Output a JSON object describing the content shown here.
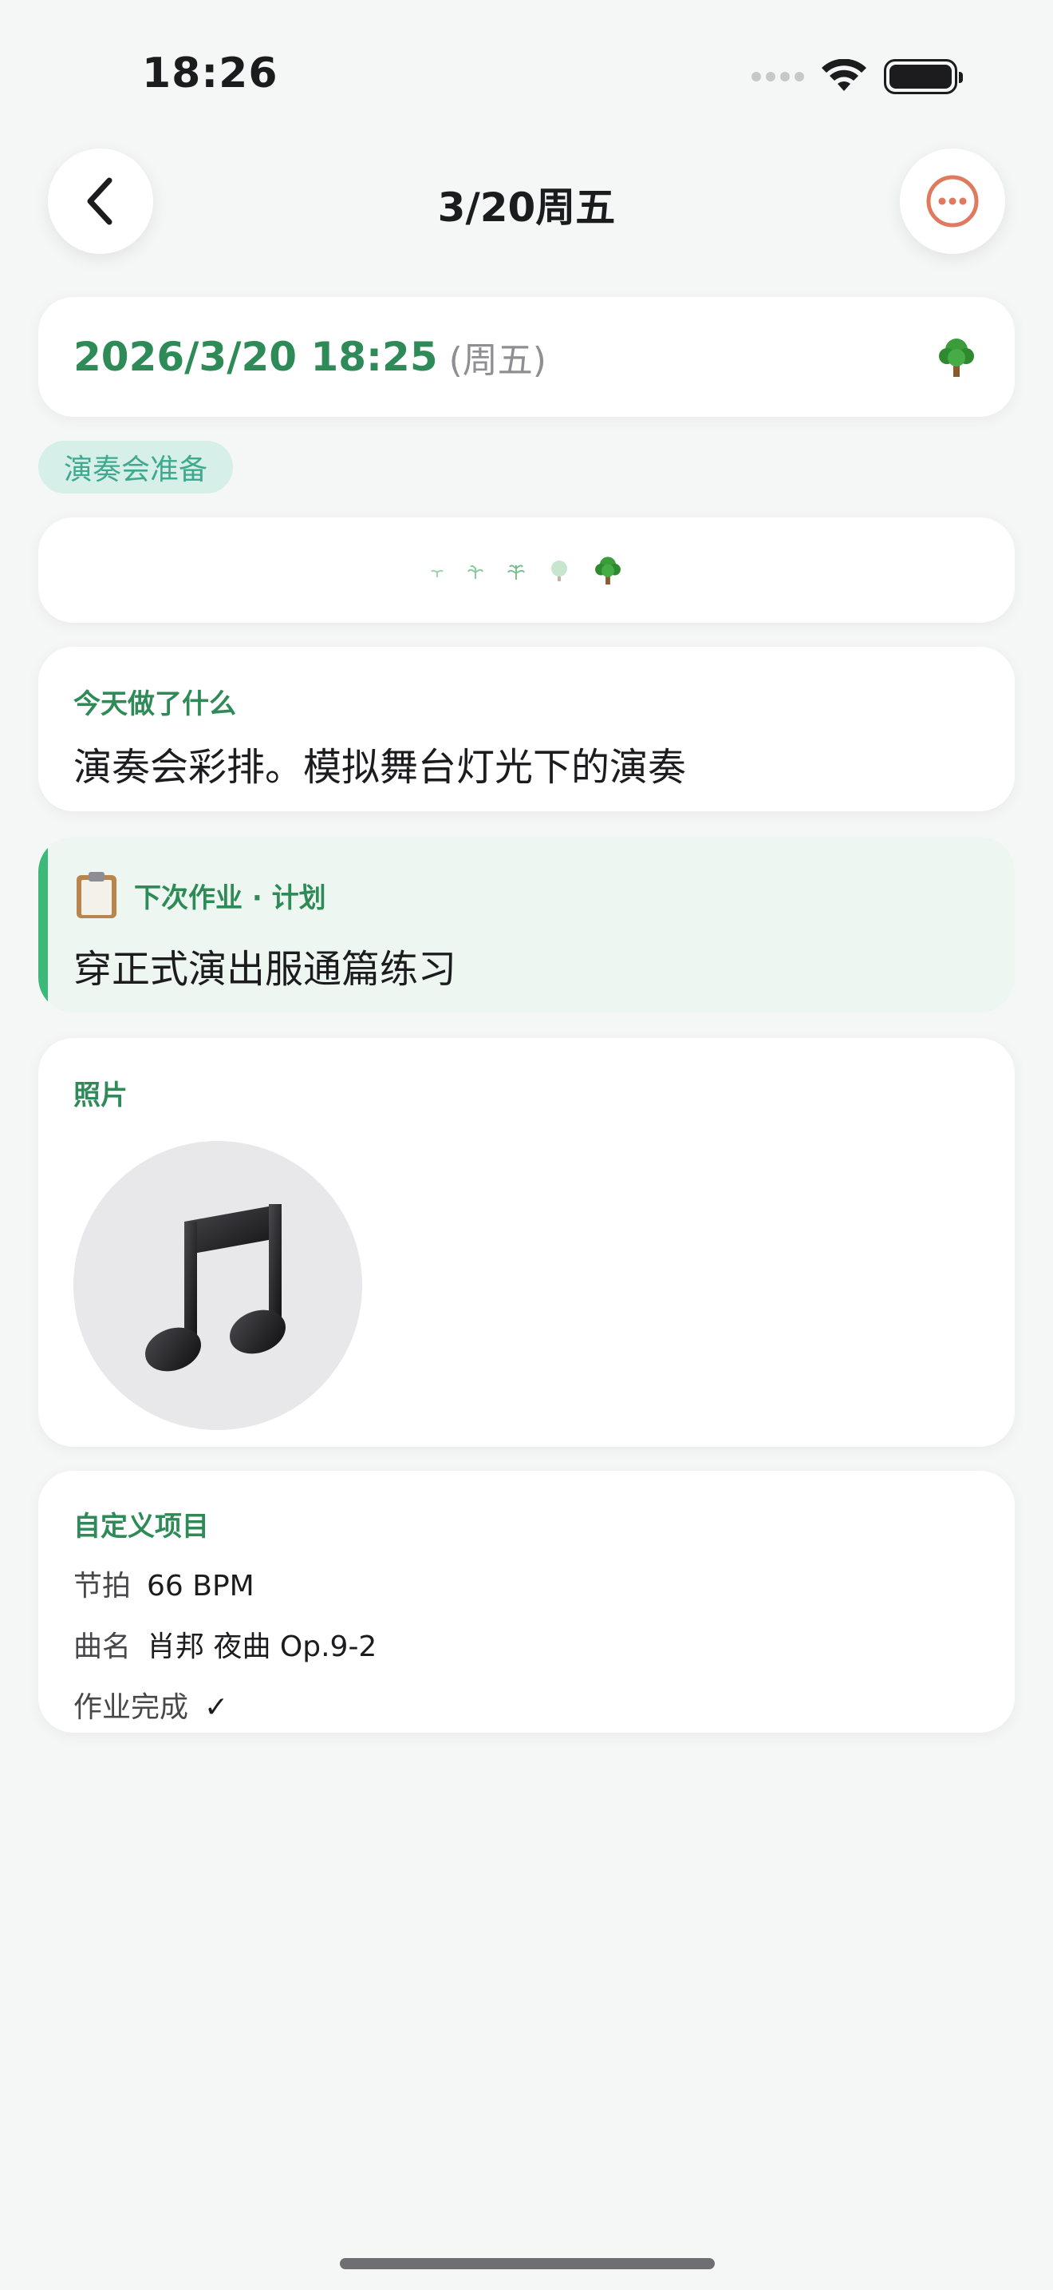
{
  "status": {
    "time": "18:26"
  },
  "nav": {
    "title": "3/20周五",
    "back_icon": "chevron-left-icon",
    "more_icon": "ellipsis-circle-icon",
    "accent": "#e07a5f"
  },
  "entry": {
    "date": "2026/3/20 18:25",
    "weekday": "(周五)",
    "tag": "演奏会准备",
    "today_title": "今天做了什么",
    "today_text": "演奏会彩排。模拟舞台灯光下的演奏",
    "plan_title": "下次作业 · 计划",
    "plan_text": "穿正式演出服通篇练习",
    "photos_title": "照片",
    "custom_title": "自定义项目",
    "custom_items": [
      {
        "key": "节拍",
        "value": "66 BPM"
      },
      {
        "key": "曲名",
        "value": "肖邦 夜曲 Op.9-2"
      },
      {
        "key": "作业完成",
        "value": "✓"
      }
    ]
  },
  "colors": {
    "primary_green": "#2e8b57",
    "tag_bg": "#d6efe8",
    "plan_bg": "#eef6f2",
    "plan_bar": "#3cb878"
  }
}
